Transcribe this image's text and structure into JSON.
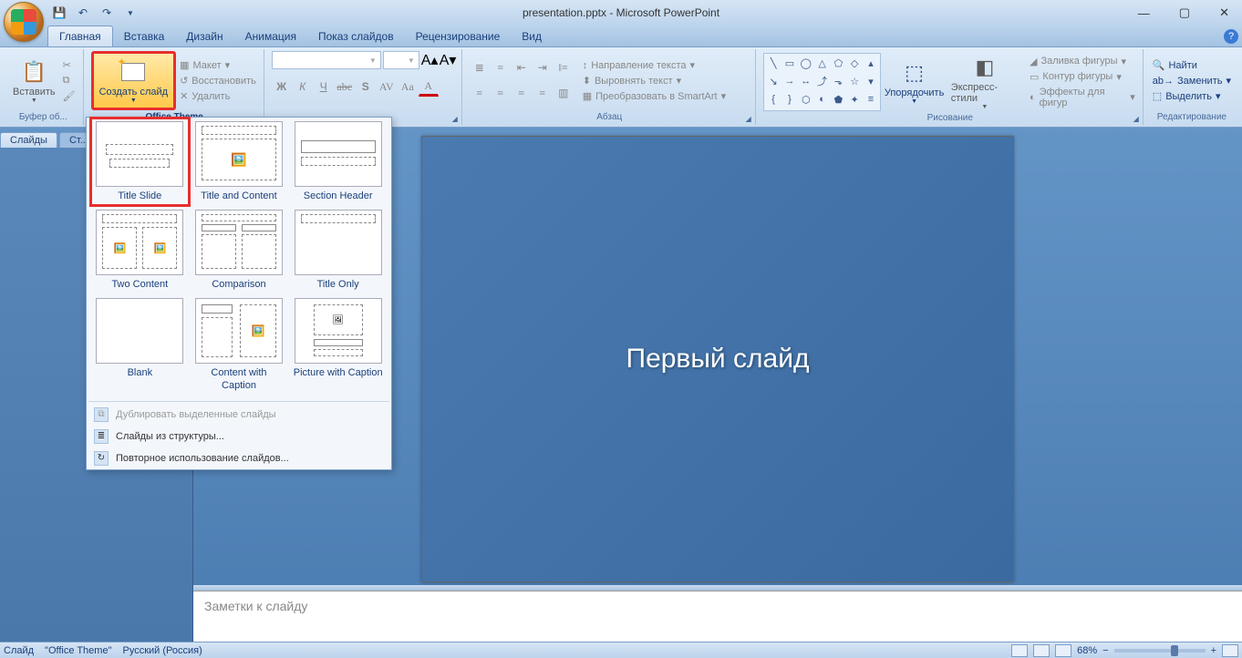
{
  "window": {
    "title": "presentation.pptx - Microsoft PowerPoint"
  },
  "tabs": {
    "home": "Главная",
    "insert": "Вставка",
    "design": "Дизайн",
    "animation": "Анимация",
    "slideshow": "Показ слайдов",
    "review": "Рецензирование",
    "view": "Вид"
  },
  "ribbon": {
    "clipboard": {
      "paste": "Вставить",
      "label": "Буфер об..."
    },
    "slides": {
      "new_slide": "Создать слайд",
      "layout": "Макет",
      "reset": "Восстановить",
      "delete": "Удалить",
      "theme_header": "Office Theme"
    },
    "font": {
      "label": ""
    },
    "paragraph": {
      "text_direction": "Направление текста",
      "align_text": "Выровнять текст",
      "convert_smartart": "Преобразовать в SmartArt",
      "label": "Абзац"
    },
    "drawing": {
      "arrange": "Упорядочить",
      "quick_styles": "Экспресс-стили",
      "shape_fill": "Заливка фигуры",
      "shape_outline": "Контур фигуры",
      "shape_effects": "Эффекты для фигур",
      "label": "Рисование"
    },
    "editing": {
      "find": "Найти",
      "replace": "Заменить",
      "select": "Выделить",
      "label": "Редактирование"
    }
  },
  "panel_tabs": {
    "slides": "Слайды",
    "outline": "Ст..."
  },
  "layouts": {
    "items": [
      {
        "label": "Title Slide"
      },
      {
        "label": "Title and Content"
      },
      {
        "label": "Section Header"
      },
      {
        "label": "Two Content"
      },
      {
        "label": "Comparison"
      },
      {
        "label": "Title Only"
      },
      {
        "label": "Blank"
      },
      {
        "label": "Content with Caption"
      },
      {
        "label": "Picture with Caption"
      }
    ],
    "menu": {
      "duplicate": "Дублировать выделенные слайды",
      "from_outline": "Слайды из структуры...",
      "reuse": "Повторное использование слайдов..."
    }
  },
  "slide": {
    "title": "Первый слайд",
    "notes_placeholder": "Заметки к слайду"
  },
  "statusbar": {
    "slide_info": "Слайд",
    "theme": "\"Office Theme\"",
    "language": "Русский (Россия)",
    "zoom": "68%"
  }
}
